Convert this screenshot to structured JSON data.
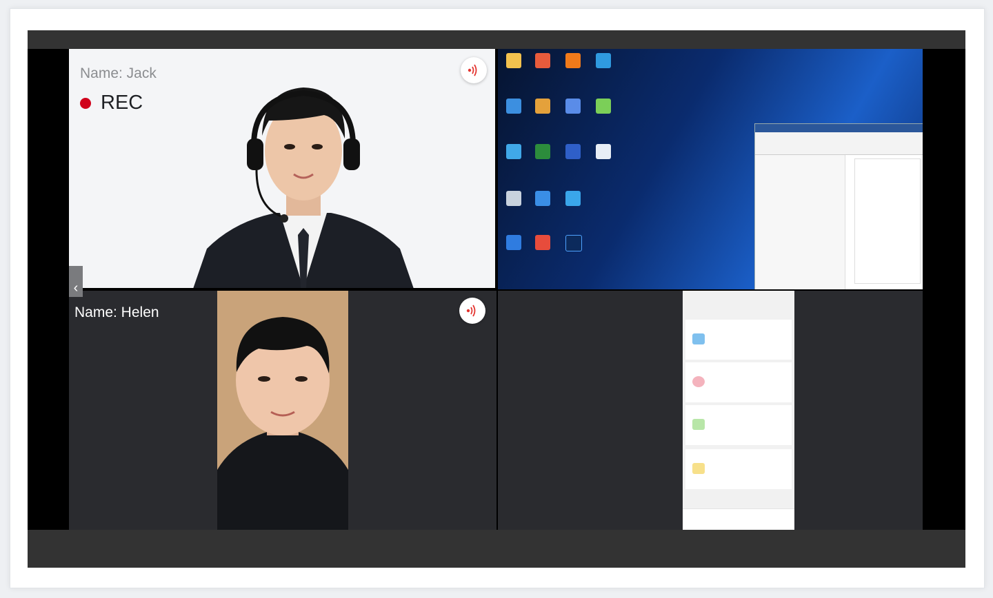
{
  "participants": [
    {
      "name_label": "Name: Jack",
      "recording": true,
      "rec_label": "REC"
    },
    {
      "name_label": "Name: Helen",
      "recording": false
    }
  ],
  "colors": {
    "rec_dot": "#d0021b",
    "audio_icon": "#e3342f",
    "bar": "#333333"
  },
  "icons": [
    "audio-volume-icon",
    "chevron-left-icon"
  ],
  "collapse_glyph": "‹"
}
